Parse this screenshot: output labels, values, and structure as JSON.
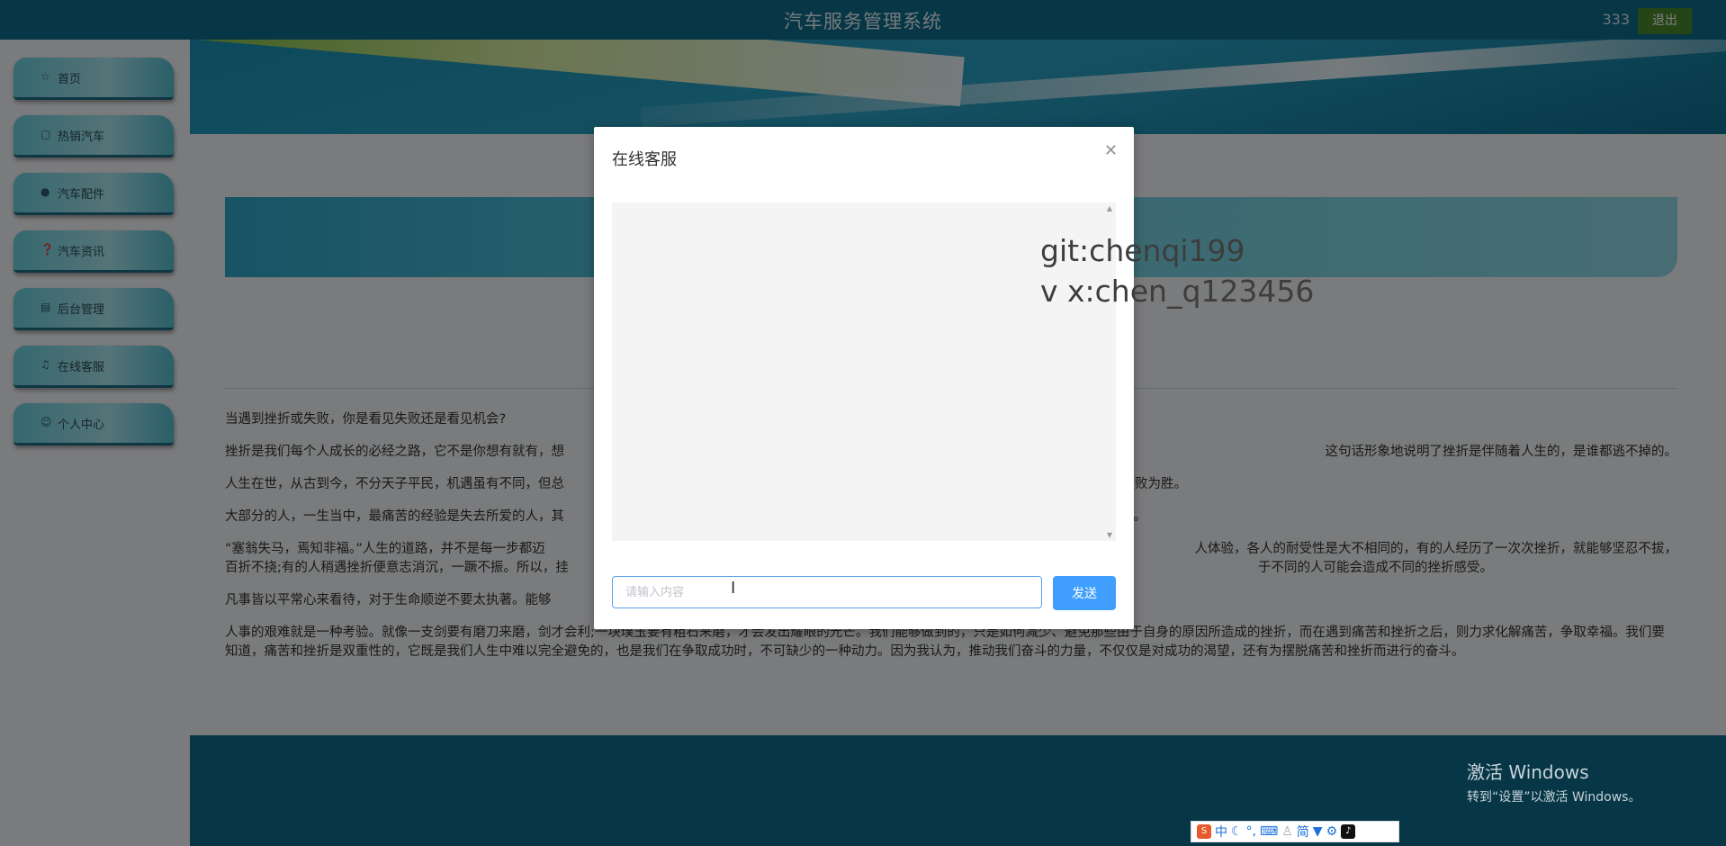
{
  "app": {
    "title": "汽车服务管理系统",
    "username": "333",
    "logout_label": "退出"
  },
  "sidebar": {
    "items": [
      {
        "label": "首页",
        "icon": "star-icon"
      },
      {
        "label": "热销汽车",
        "icon": "bag-icon"
      },
      {
        "label": "汽车配件",
        "icon": "info-icon"
      },
      {
        "label": "汽车资讯",
        "icon": "question-icon"
      },
      {
        "label": "后台管理",
        "icon": "building-icon"
      },
      {
        "label": "在线客服",
        "icon": "headset-icon"
      },
      {
        "label": "个人中心",
        "icon": "user-icon"
      }
    ]
  },
  "article": {
    "paragraphs": [
      "当遇到挫折或失败，你是看见失败还是看见机会?",
      "挫折是我们每个人成长的必经之路，它不是你想有就有，想",
      "人生在世，从古到今，不分天子平民，机遇虽有不同，但总",
      "大部分的人，一生当中，最痛苦的经验是失去所爱的人，其",
      "“塞翁失马，焉知非福。”人生的道路，并不是每一步都迈",
      "凡事皆以平常心来看待，对于生命顺逆不要太执著。能够",
      "人事的艰难就是一种考验。就像一支剑要有磨刀来磨，剑才会利;一块璞玉要有粗石来磨，才会发出耀眼的光芒。我们能够做到的，只是如何减少、避免那些由于自身的原因所造成的挫折，而在遇到痛苦和挫折之后，则力求化解痛苦，争取幸福。我们要知道，痛苦和挫折是双重性的，它既是我们人生中难以完全避免的，也是我们在争取成功时，不可缺少的一种动力。因为我认为，推动我们奋斗的力量，不仅仅是对成功的渴望，还有为摆脱痛苦和挫折而进行的奋斗。"
    ],
    "right_fragments": [
      "这句话形象地说明了挫折是伴随着人生的，是谁都逃不掉的。",
      "败为胜。",
      "。",
      "人体验，各人的耐受性是大不相同的，有的人经历了一次次挫折，就能够坚忍不拔，",
      "于不同的人可能会造成不同的挫折感受。"
    ],
    "p5_line2_left": "百折不挠;有的人稍遇挫折便意志消沉，一蹶不振。所以，挂"
  },
  "modal": {
    "title": "在线客服",
    "input_placeholder": "请输入内容",
    "send_label": "发送"
  },
  "watermark": {
    "line1": "git:chenqi199",
    "line2": "v x:chen_q123456"
  },
  "windows_notice": {
    "line1": "激活 Windows",
    "line2": "转到“设置”以激活 Windows。"
  },
  "ime": {
    "lang": "中",
    "mode": "简"
  }
}
